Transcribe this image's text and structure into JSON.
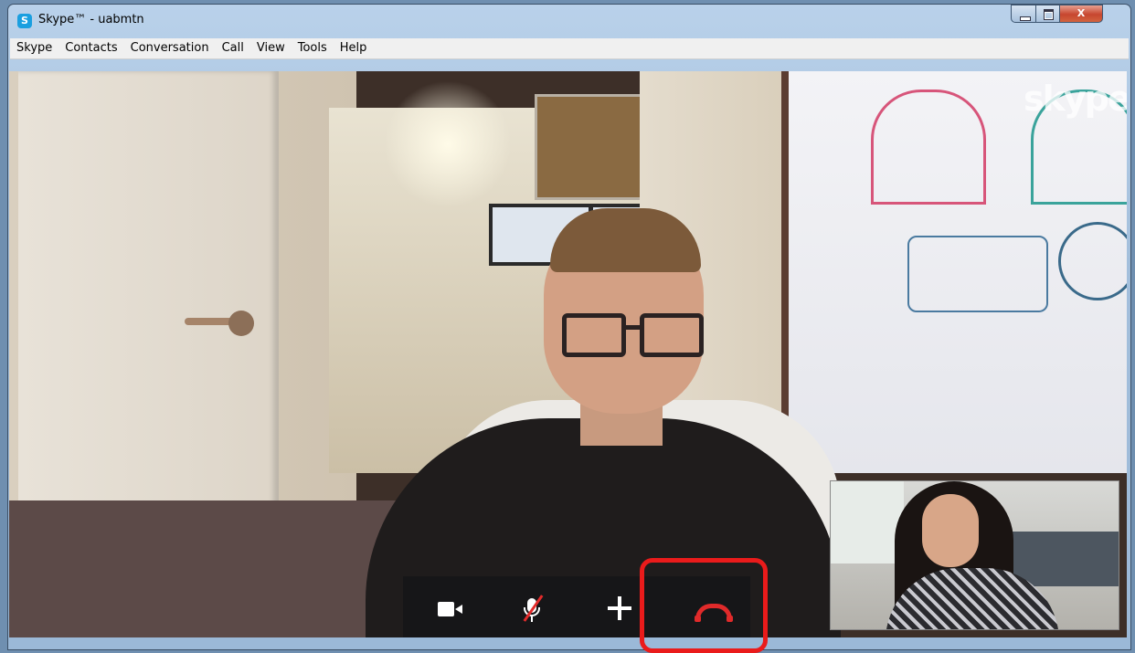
{
  "window": {
    "app_icon_letter": "S",
    "title": "Skype™ - uabmtn",
    "minimize_icon": "minimize-icon",
    "maximize_icon": "maximize-icon",
    "close_glyph": "X"
  },
  "menu": {
    "items": [
      "Skype",
      "Contacts",
      "Conversation",
      "Call",
      "View",
      "Tools",
      "Help"
    ]
  },
  "video": {
    "watermark": "skype"
  },
  "call_controls": {
    "video_icon": "video-camera-icon",
    "mic_icon": "microphone-muted-icon",
    "add_icon": "plus-icon",
    "end_icon": "hang-up-icon",
    "end_color": "#e02a2a"
  },
  "colors": {
    "highlight": "#ea1b1b",
    "control_bar": "#161618"
  }
}
